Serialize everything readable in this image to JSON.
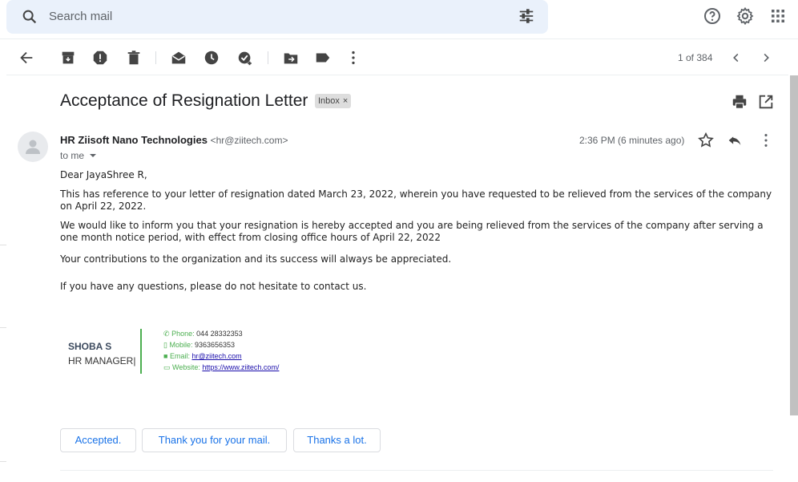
{
  "search": {
    "placeholder": "Search mail"
  },
  "toolbar": {
    "pager": "1 of 384"
  },
  "email": {
    "subject": "Acceptance of Resignation Letter",
    "label": "Inbox",
    "label_close": "×",
    "sender_name": "HR Ziisoft Nano Technologies",
    "sender_email": "<hr@ziitech.com>",
    "to": "to me",
    "time": "2:36 PM (6 minutes ago)",
    "greeting": "Dear JayaShree R,",
    "para1": "This has reference to your letter of resignation dated March 23, 2022, wherein you have requested to be relieved from the services of the company on April 22, 2022.",
    "para2": "We would like to inform you that your resignation is hereby accepted and you are being relieved from the services of the company after serving a one month notice period, with effect from closing office hours of April 22, 2022",
    "para3": "Your contributions to the organization and its success will always be appreciated.",
    "para4": "If you have any questions, please do not hesitate to contact us."
  },
  "signature": {
    "name": "SHOBA S",
    "title": "HR MANAGER|",
    "phone_label": "Phone:",
    "phone": "044 28332353",
    "mobile_label": "Mobile:",
    "mobile": "9363656353",
    "email_label": "Email:",
    "email": "hr@ziitech.com",
    "website_label": "Website:",
    "website": "https://www.ziitech.com/"
  },
  "smart_replies": [
    "Accepted.",
    "Thank you for your mail.",
    "Thanks a lot."
  ],
  "colors": {
    "accent": "#1a73e8",
    "search_bg": "#eaf1fb",
    "signature_green": "#4caf50"
  }
}
